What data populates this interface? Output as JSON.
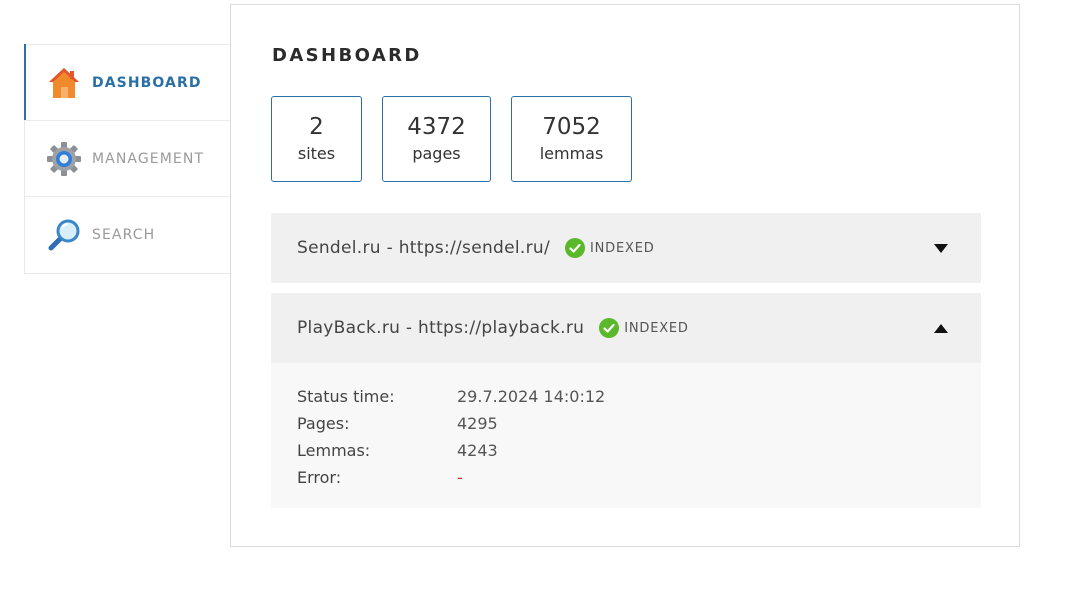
{
  "sidebar": {
    "items": [
      {
        "label": "DASHBOARD",
        "icon": "home-icon"
      },
      {
        "label": "MANAGEMENT",
        "icon": "gear-icon"
      },
      {
        "label": "SEARCH",
        "icon": "magnifier-icon"
      }
    ]
  },
  "main": {
    "title": "DASHBOARD",
    "stats": [
      {
        "value": "2",
        "label": "sites"
      },
      {
        "value": "4372",
        "label": "pages"
      },
      {
        "value": "7052",
        "label": "lemmas"
      }
    ],
    "sites": [
      {
        "title": "Sendel.ru - https://sendel.ru/",
        "status": "INDEXED",
        "expanded": false
      },
      {
        "title": "PlayBack.ru - https://playback.ru",
        "status": "INDEXED",
        "expanded": true,
        "details": {
          "status_time_label": "Status time:",
          "status_time": "29.7.2024 14:0:12",
          "pages_label": "Pages:",
          "pages": "4295",
          "lemmas_label": "Lemmas:",
          "lemmas": "4243",
          "error_label": "Error:",
          "error": "-"
        }
      }
    ]
  },
  "colors": {
    "accent": "#2a6fa6",
    "indexed": "#5cb82b",
    "error": "#c0392b"
  }
}
